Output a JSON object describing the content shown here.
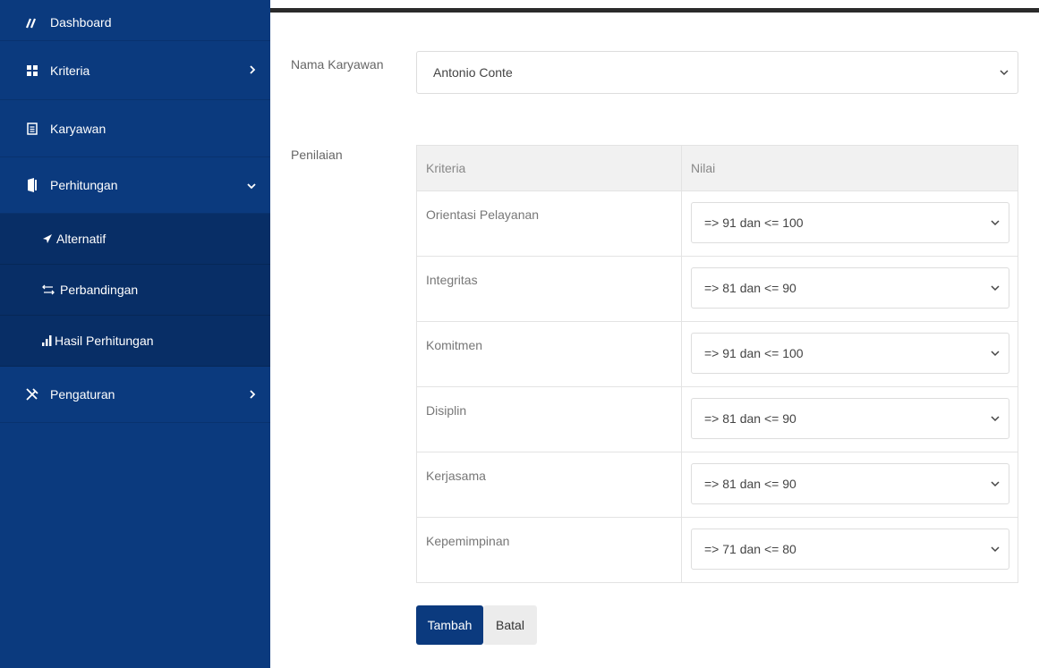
{
  "sidebar": {
    "items": [
      {
        "label": "Dashboard",
        "icon": "dashboard-icon"
      },
      {
        "label": "Kriteria",
        "icon": "grid-icon"
      },
      {
        "label": "Karyawan",
        "icon": "document-icon"
      },
      {
        "label": "Perhitungan",
        "icon": "wallet-icon"
      },
      {
        "label": "Pengaturan",
        "icon": "tools-icon"
      }
    ],
    "subitems": [
      {
        "label": "Alternatif",
        "icon": "send-icon"
      },
      {
        "label": "Perbandingan",
        "icon": "exchange-icon"
      },
      {
        "label": "Hasil Perhitungan",
        "icon": "bar-chart-icon"
      }
    ]
  },
  "form": {
    "employee_label": "Nama Karyawan",
    "employee_value": "Antonio Conte",
    "assessment_label": "Penilaian",
    "table": {
      "headers": [
        "Kriteria",
        "Nilai"
      ],
      "rows": [
        {
          "criteria": "Orientasi Pelayanan",
          "value": "=> 91 dan <= 100"
        },
        {
          "criteria": "Integritas",
          "value": "=> 81 dan <= 90"
        },
        {
          "criteria": "Komitmen",
          "value": "=> 91 dan <= 100"
        },
        {
          "criteria": "Disiplin",
          "value": "=> 81 dan <= 90"
        },
        {
          "criteria": "Kerjasama",
          "value": "=> 81 dan <= 90"
        },
        {
          "criteria": "Kepemimpinan",
          "value": "=> 71 dan <= 80"
        }
      ]
    },
    "add_button": "Tambah",
    "cancel_button": "Batal"
  },
  "colors": {
    "sidebar": "#0b3a7e",
    "sidebar_sub": "#082e66",
    "primary_button": "#0b3a7e"
  }
}
